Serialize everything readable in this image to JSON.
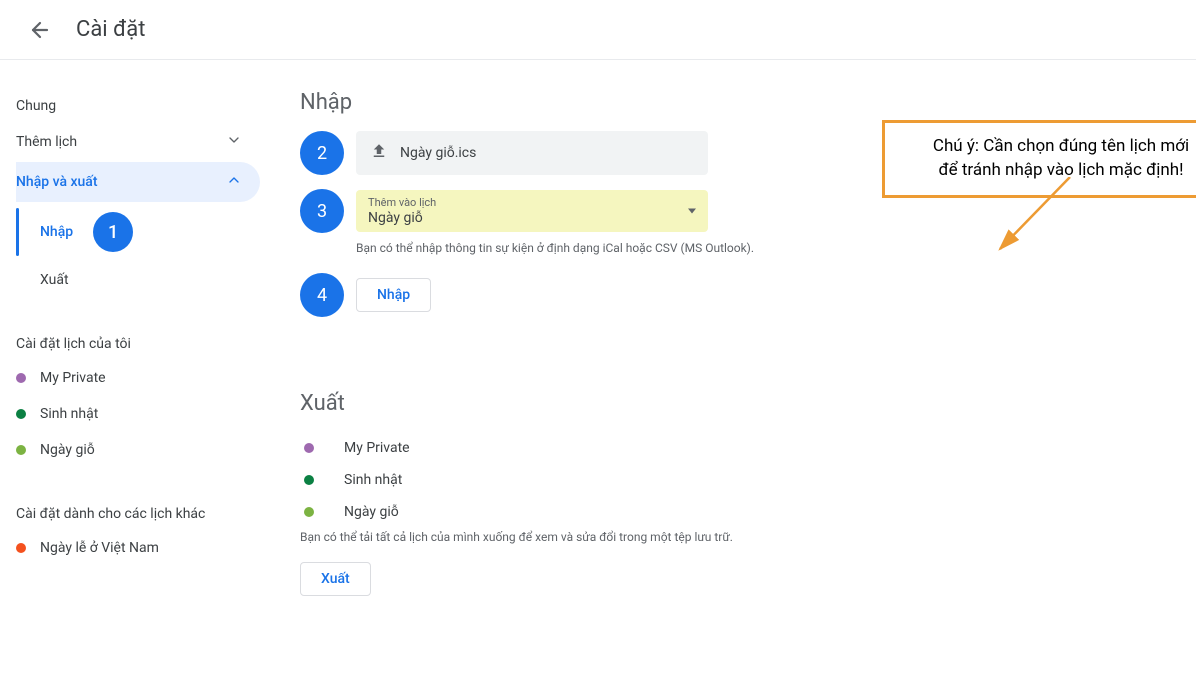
{
  "header": {
    "title": "Cài đặt"
  },
  "sidebar": {
    "general": "Chung",
    "add_calendar": "Thêm lịch",
    "import_export": "Nhập và xuất",
    "sub_import": "Nhập",
    "sub_export": "Xuất",
    "my_calendars_heading": "Cài đặt lịch của tôi",
    "my_calendars": [
      {
        "label": "My Private",
        "color": "#9e69af"
      },
      {
        "label": "Sinh nhật",
        "color": "#0b8043"
      },
      {
        "label": "Ngày giỗ",
        "color": "#7cb342"
      }
    ],
    "other_calendars_heading": "Cài đặt dành cho các lịch khác",
    "other_calendars": [
      {
        "label": "Ngày lễ ở Việt Nam",
        "color": "#f4511e"
      }
    ]
  },
  "steps": {
    "s1": "1",
    "s2": "2",
    "s3": "3",
    "s4": "4"
  },
  "import": {
    "heading": "Nhập",
    "file_name": "Ngày giỗ.ics",
    "select_label": "Thêm vào lịch",
    "select_value": "Ngày giỗ",
    "help": "Bạn có thể nhập thông tin sự kiện ở định dạng iCal hoặc CSV (MS Outlook).",
    "button": "Nhập"
  },
  "export": {
    "heading": "Xuất",
    "items": [
      {
        "label": "My Private",
        "color": "#9e69af"
      },
      {
        "label": "Sinh nhật",
        "color": "#0b8043"
      },
      {
        "label": "Ngày giỗ",
        "color": "#7cb342"
      }
    ],
    "help": "Bạn có thể tải tất cả lịch của mình xuống để xem và sửa đổi trong một tệp lưu trữ.",
    "button": "Xuất"
  },
  "callout": {
    "line1": "Chú ý: Cần chọn đúng tên lịch mới",
    "line2": "để tránh nhập vào lịch mặc định!"
  }
}
